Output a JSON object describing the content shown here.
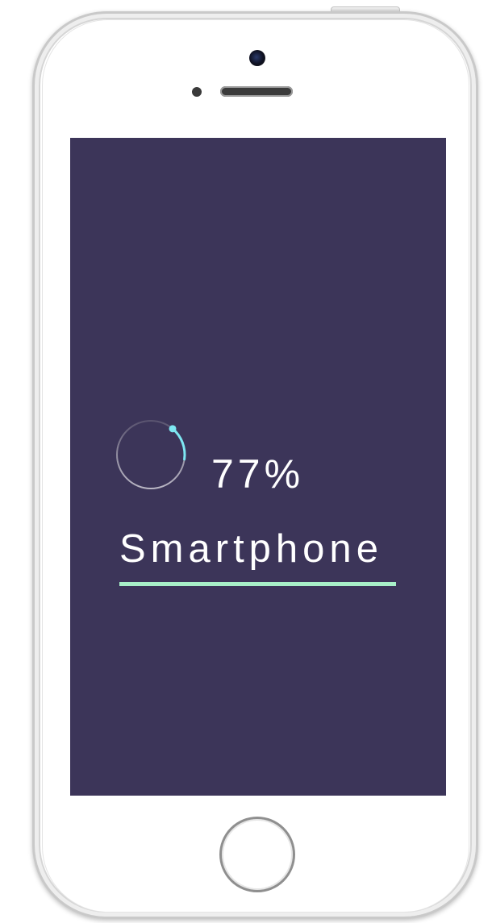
{
  "screen": {
    "progress_percent": 77,
    "progress_text": "77%",
    "label": "Smartphone"
  },
  "colors": {
    "screen_background": "#3c3559",
    "progress_track": "#8a8699",
    "progress_arc": "#7ee7f2",
    "underline_accent": "#a8f0c8",
    "text": "#ffffff"
  },
  "icons": {
    "progress_indicator": "circular-progress-icon",
    "camera": "front-camera-icon",
    "home": "home-button-icon"
  }
}
